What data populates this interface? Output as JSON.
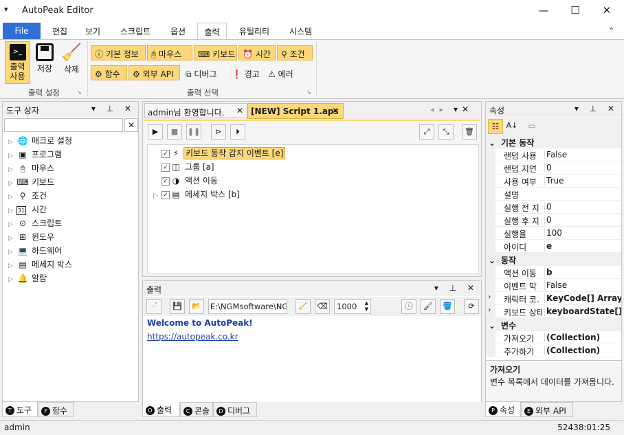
{
  "window": {
    "title": "AutoPeak Editor",
    "sys_menu": "▾",
    "minimize": "—",
    "maximize": "☐",
    "close": "✕"
  },
  "menu": {
    "file": "File",
    "edit": "편집",
    "view": "보기",
    "script": "스크립트",
    "options": "옵션",
    "output": "출력",
    "utility": "유틸리티",
    "system": "시스템",
    "collapse": "⌃"
  },
  "ribbon": {
    "output_use": "출력\n사용",
    "save": "저장",
    "delete": "삭제",
    "group1_label": "출력 설정",
    "group2_label": "출력 선택",
    "basic_info": "기본 정보",
    "mouse": "마우스",
    "keyboard": "키보드",
    "time": "시간",
    "condition": "조건",
    "function": "함수",
    "external_api": "외부 API",
    "debug": "디버그",
    "warning": "경고",
    "error": "에러"
  },
  "toolbox": {
    "title": "도구 상자",
    "search_value": "",
    "items": [
      {
        "label": "매크로 설정",
        "icon": "globe-icon"
      },
      {
        "label": "프로그램",
        "icon": "program-icon"
      },
      {
        "label": "마우스",
        "icon": "mouse-icon"
      },
      {
        "label": "키보드",
        "icon": "keyboard-icon"
      },
      {
        "label": "조건",
        "icon": "condition-icon"
      },
      {
        "label": "시간",
        "icon": "calendar-icon"
      },
      {
        "label": "스크립트",
        "icon": "script-icon"
      },
      {
        "label": "윈도우",
        "icon": "windows-icon"
      },
      {
        "label": "하드웨어",
        "icon": "laptop-icon"
      },
      {
        "label": "메세지 박스",
        "icon": "message-icon"
      },
      {
        "label": "알람",
        "icon": "bell-icon"
      }
    ],
    "calendar_num": "31",
    "tabs": [
      {
        "badge": "T",
        "label": "도구"
      },
      {
        "badge": "F",
        "label": "함수"
      }
    ]
  },
  "editor": {
    "tabs": [
      {
        "label": "admin님 환영합니다.",
        "close": "✕"
      },
      {
        "label": "[NEW] Script 1.aps",
        "close": "✕"
      }
    ],
    "nodes": [
      {
        "label": "키보드 동작 감지 이벤트 [e]",
        "check": "✓",
        "icon": "⚡",
        "expander": ""
      },
      {
        "label": "그룹 [a]",
        "check": "✓",
        "icon": "◫",
        "expander": ""
      },
      {
        "label": "액션 이동",
        "check": "✓",
        "icon": "◑",
        "expander": ""
      },
      {
        "label": "메세지 박스 [b]",
        "check": "✓",
        "icon": "▤",
        "expander": "▷"
      }
    ]
  },
  "output": {
    "title": "출력",
    "path_value": "E:\\NGMsoftware\\NG",
    "number_value": "1000",
    "lines": [
      "Welcome to AutoPeak!",
      "https://autopeak.co.kr"
    ],
    "tabs": [
      {
        "badge": "O",
        "label": "출력"
      },
      {
        "badge": "C",
        "label": "콘솔"
      },
      {
        "badge": "D",
        "label": "디버그"
      }
    ]
  },
  "properties": {
    "title": "속성",
    "categories": [
      {
        "name": "기본 동작",
        "toggle": "⌄",
        "rows": [
          {
            "key": "랜덤 사용",
            "value": "False",
            "bold": false
          },
          {
            "key": "랜덤 지연",
            "value": "0",
            "bold": false
          },
          {
            "key": "사용 여부",
            "value": "True",
            "bold": false
          },
          {
            "key": "설명",
            "value": "",
            "bold": false
          },
          {
            "key": "실행 전 지",
            "value": "0",
            "bold": false
          },
          {
            "key": "실행 후 지",
            "value": "0",
            "bold": false
          },
          {
            "key": "실행율",
            "value": "100",
            "bold": false
          },
          {
            "key": "아이디",
            "value": "e",
            "bold": true
          }
        ]
      },
      {
        "name": "동작",
        "toggle": "⌄",
        "rows": [
          {
            "key": "액션 이동",
            "value": "b",
            "bold": true,
            "exp": ""
          },
          {
            "key": "이벤트 막",
            "value": "False",
            "bold": false,
            "exp": ""
          },
          {
            "key": "캐릭터 코.",
            "value": "KeyCode[] Array",
            "bold": true,
            "exp": "›"
          },
          {
            "key": "키보드 상태",
            "value": "keyboardState[] Ar",
            "bold": true,
            "exp": "›"
          }
        ]
      },
      {
        "name": "변수",
        "toggle": "⌄",
        "rows": [
          {
            "key": "가져오기",
            "value": "(Collection)",
            "bold": true
          },
          {
            "key": "추가하기",
            "value": "(Collection)",
            "bold": true
          }
        ]
      }
    ],
    "desc_title": "가져오기",
    "desc_text": "변수 목록에서 데이터를 가져옵니다.",
    "tabs": [
      {
        "badge": "P",
        "label": "속성"
      },
      {
        "badge": "E",
        "label": "외부 API"
      }
    ]
  },
  "status": {
    "user": "admin",
    "time": "52438:01:25"
  },
  "colors": {
    "accent": "#2f6fd6",
    "highlight": "#fcd87a",
    "link": "#1a3fa8"
  }
}
